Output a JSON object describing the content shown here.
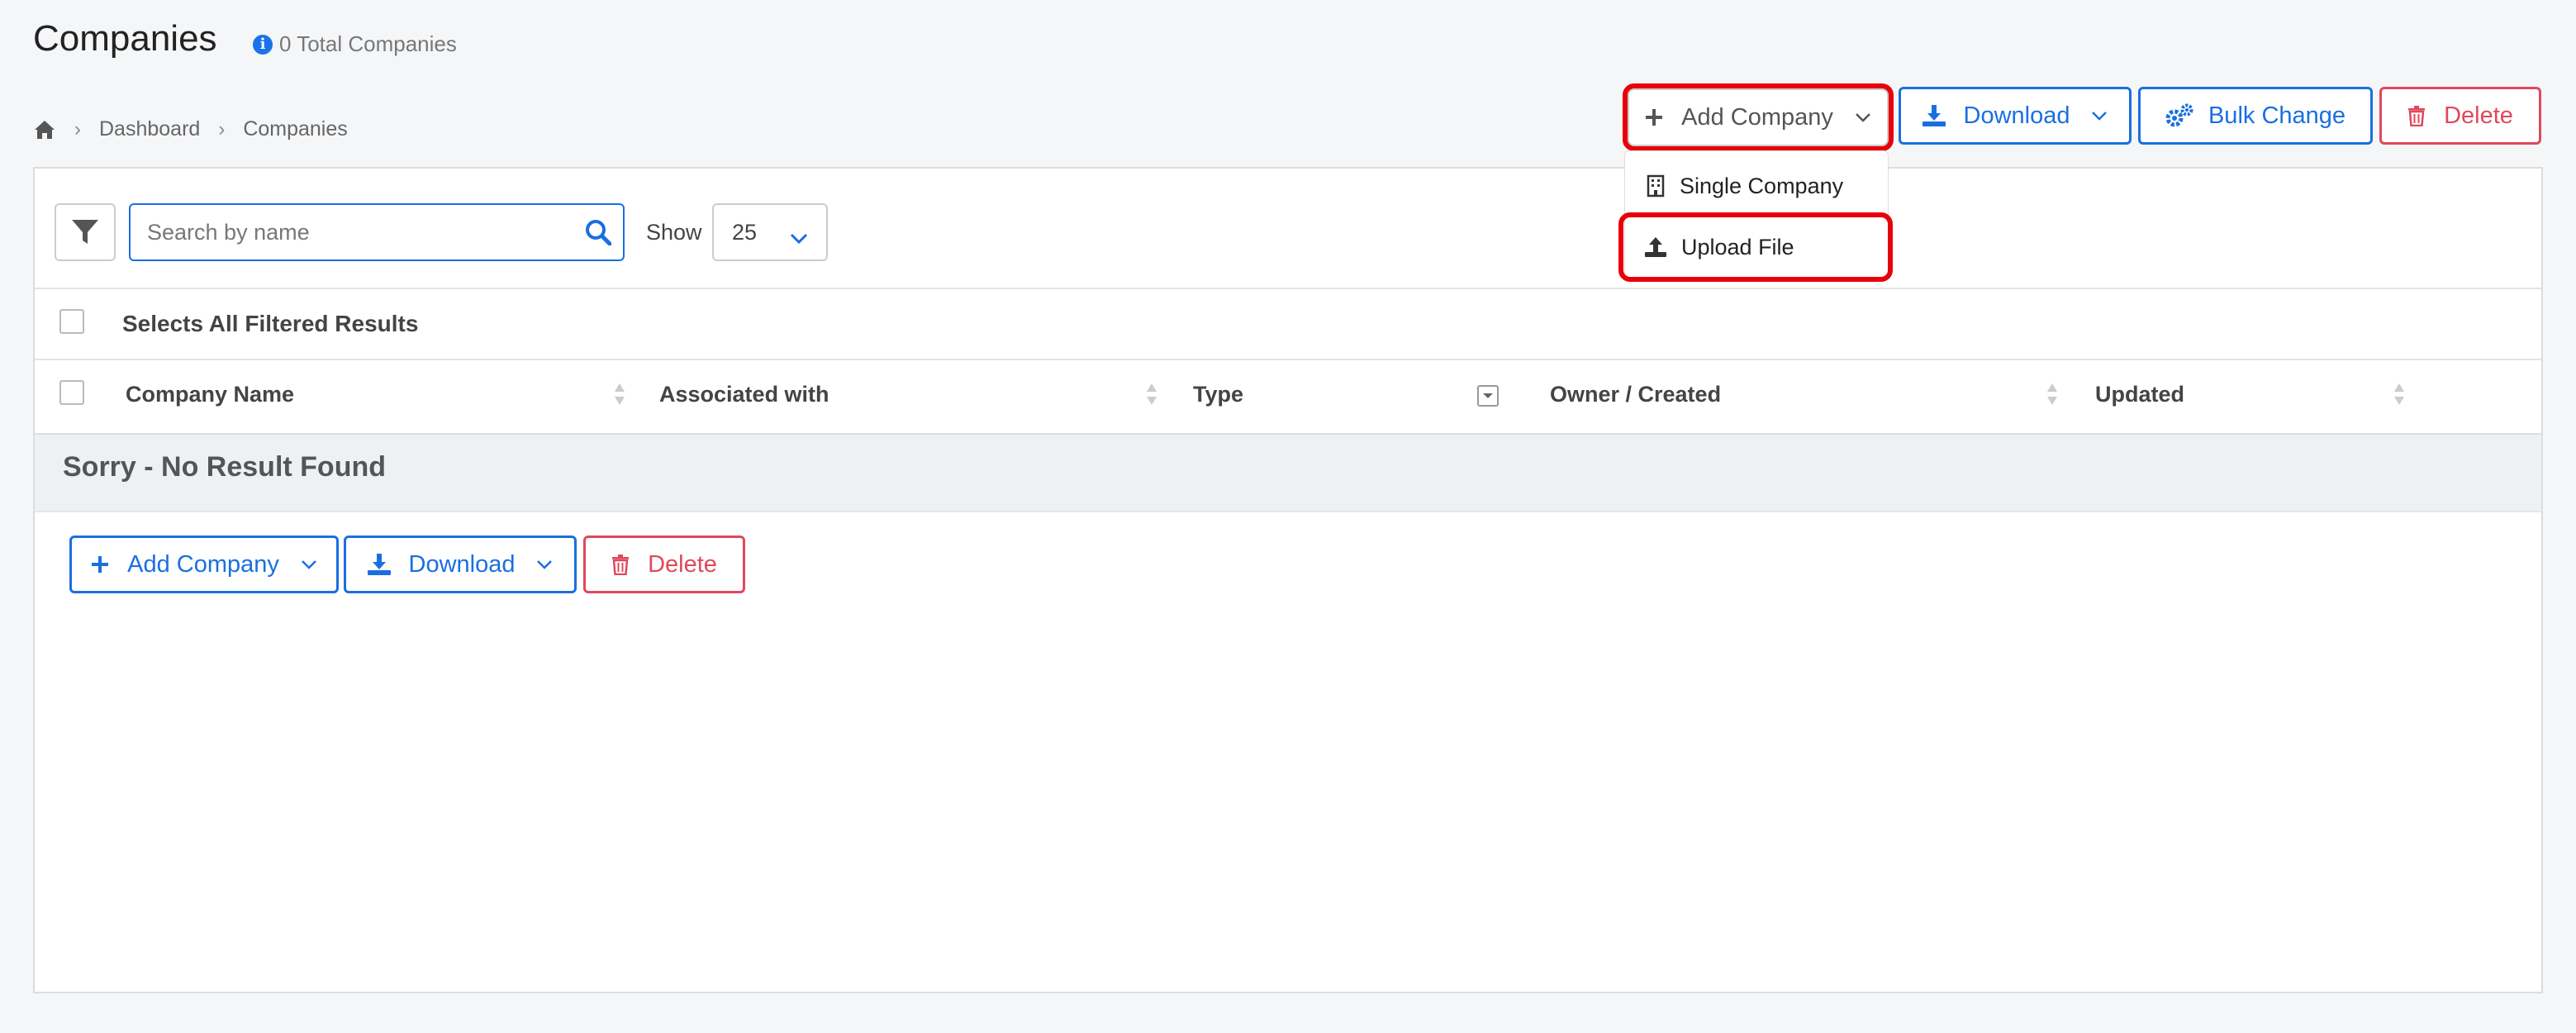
{
  "header": {
    "title": "Companies",
    "total": "0 Total Companies"
  },
  "breadcrumb": [
    "Dashboard",
    "Companies"
  ],
  "toolbar": {
    "add_company": "Add Company",
    "download": "Download",
    "bulk_change": "Bulk Change",
    "delete": "Delete"
  },
  "dropdown": {
    "single_company": "Single Company",
    "upload_file": "Upload File"
  },
  "search": {
    "placeholder": "Search by name"
  },
  "show": {
    "label": "Show",
    "value": "25"
  },
  "table": {
    "select_all": "Selects All Filtered Results",
    "columns": [
      "Company Name",
      "Associated with",
      "Type",
      "Owner / Created",
      "Updated"
    ],
    "empty": "Sorry - No Result Found"
  },
  "bottom_toolbar": {
    "add_company": "Add Company",
    "download": "Download",
    "delete": "Delete"
  },
  "colors": {
    "primary": "#1a6fe0",
    "danger": "#e0485b",
    "highlight": "#e8000b"
  }
}
